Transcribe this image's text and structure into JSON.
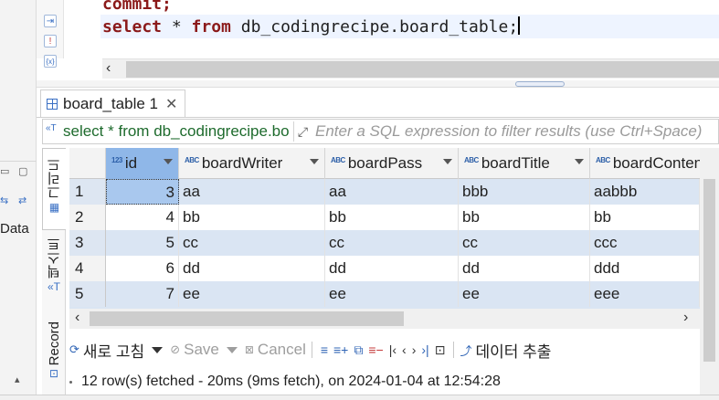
{
  "editor": {
    "lines": [
      {
        "kw": "commit",
        "rest": ";"
      },
      {
        "kw1": "select",
        "mid1": " * ",
        "kw2": "from",
        "rest": " db_codingrecipe.board_table;"
      }
    ]
  },
  "outer": {
    "data_label": "Data"
  },
  "results": {
    "tab_label": "board_table 1",
    "filter_sql": "select * from db_codingrecipe.board_table",
    "filter_placeholder": "Enter a SQL expression to filter results (use Ctrl+Space)",
    "side_tabs": {
      "grid": "그리드",
      "text": "텍스트",
      "record": "Record"
    },
    "columns": [
      {
        "type": "123",
        "name": "id"
      },
      {
        "type": "ABC",
        "name": "boardWriter"
      },
      {
        "type": "ABC",
        "name": "boardPass"
      },
      {
        "type": "ABC",
        "name": "boardTitle"
      },
      {
        "type": "ABC",
        "name": "boardContents"
      }
    ],
    "rows": [
      {
        "n": "1",
        "id": "3",
        "writer": "aa",
        "pass": "aa",
        "title": "bbb",
        "contents": "aabbb"
      },
      {
        "n": "2",
        "id": "4",
        "writer": "bb",
        "pass": "bb",
        "title": "bb",
        "contents": "bb"
      },
      {
        "n": "3",
        "id": "5",
        "writer": "cc",
        "pass": "cc",
        "title": "cc",
        "contents": "ccc"
      },
      {
        "n": "4",
        "id": "6",
        "writer": "dd",
        "pass": "dd",
        "title": "dd",
        "contents": "ddd"
      },
      {
        "n": "5",
        "id": "7",
        "writer": "ee",
        "pass": "ee",
        "title": "ee",
        "contents": "eee"
      }
    ],
    "toolbar": {
      "refresh": "새로 고침",
      "save": "Save",
      "cancel": "Cancel",
      "export": "데이터 추출"
    },
    "status": "12 row(s) fetched - 20ms (9ms fetch), on 2024-01-04 at 12:54:28"
  },
  "colors": {
    "accent": "#3a70c4",
    "row_alt": "#dae5f3",
    "header_selected": "#8fb7e8",
    "keyword": "#8b1a1a"
  }
}
